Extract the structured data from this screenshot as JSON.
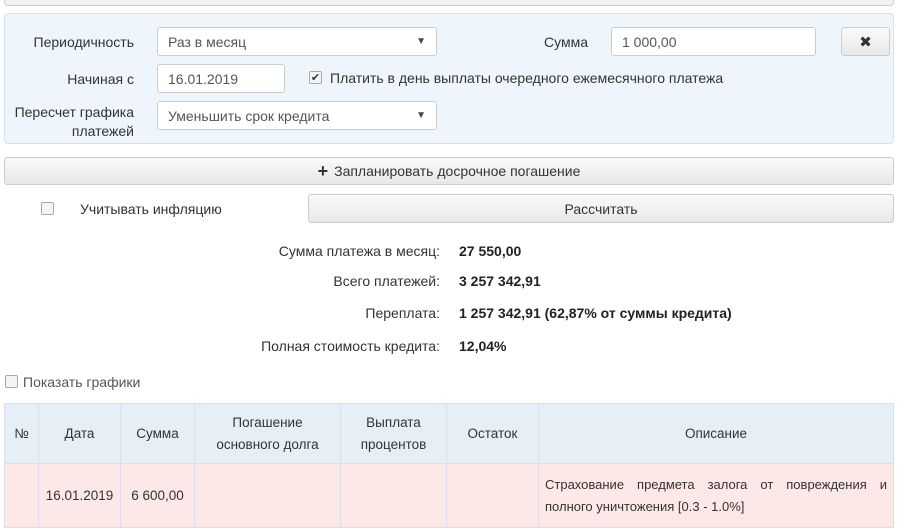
{
  "form": {
    "periodicity_label": "Периодичность",
    "periodicity_value": "Раз в месяц",
    "sum_label": "Сумма",
    "sum_value": "1 000,00",
    "start_label": "Начиная с",
    "start_value": "16.01.2019",
    "pay_on_day_label": "Платить в день выплаты очередного ежемесячного платежа",
    "recalc_label_1": "Пересчет графика",
    "recalc_label_2": "платежей",
    "recalc_value": "Уменьшить срок кредита",
    "remove_icon": "✖"
  },
  "schedule_button": "Запланировать досрочное погашение",
  "inflation_label": "Учитывать инфляцию",
  "calculate_button": "Рассчитать",
  "results": [
    {
      "label": "Сумма платежа в месяц:",
      "value": "27 550,00"
    },
    {
      "label": "Всего платежей:",
      "value": "3 257 342,91"
    },
    {
      "label": "Переплата:",
      "value": "1 257 342,91 (62,87% от суммы кредита)"
    },
    {
      "label": "Полная стоимость кредита:",
      "value": "12,04%"
    }
  ],
  "show_charts_label": "Показать графики",
  "table": {
    "headers": [
      "№",
      "Дата",
      "Сумма",
      "Погашение основного долга",
      "Выплата процентов",
      "Остаток",
      "Описание"
    ],
    "rows": [
      {
        "num": "",
        "date": "16.01.2019",
        "sum": "6 600,00",
        "principal": "",
        "interest": "",
        "balance": "",
        "desc": "Страхование предмета залога от повреждения и полного уничтожения [0.3 - 1.0%]"
      }
    ]
  }
}
